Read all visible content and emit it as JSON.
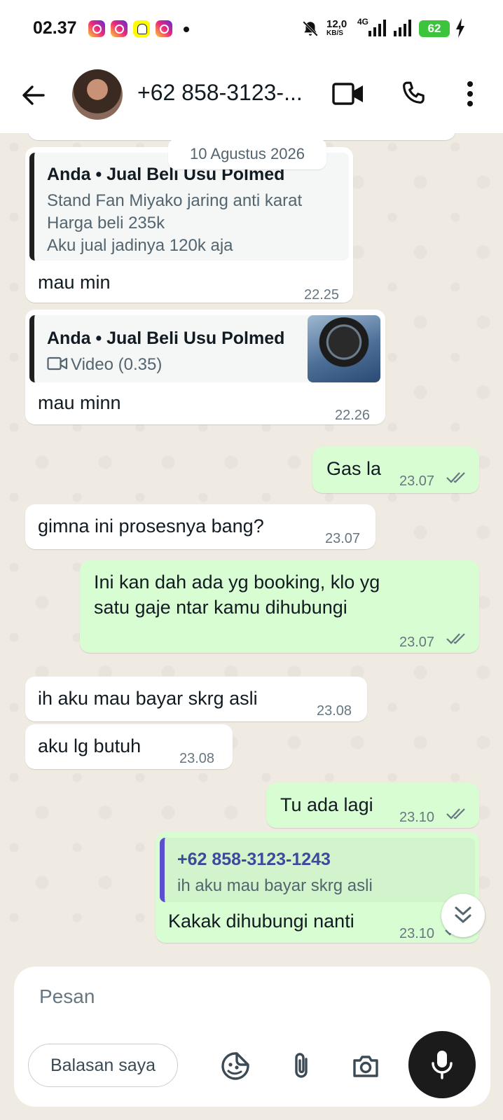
{
  "status_bar": {
    "time": "02.37",
    "net_speed": "12,0",
    "net_unit": "KB/S",
    "network_type": "4G",
    "battery": "62"
  },
  "header": {
    "contact_name": "+62 858-3123-...",
    "icons": [
      "back-arrow-icon",
      "video-call-icon",
      "voice-call-icon",
      "more-options-icon"
    ]
  },
  "chat": {
    "date_chip": "10 Agustus 2026",
    "messages": [
      {
        "direction": "in",
        "quote_author": "Anda • Jual Beli Usu Polmed",
        "quote_lines": [
          "Stand Fan Miyako jaring anti karat",
          "Harga beli 235k",
          "Aku jual jadinya 120k aja"
        ],
        "text": "mau min",
        "time": "22.25"
      },
      {
        "direction": "in",
        "quote_author": "Anda • Jual Beli Usu Polmed",
        "quote_media": "Video (0.35)",
        "text": "mau minn",
        "time": "22.26"
      },
      {
        "direction": "out",
        "text": "Gas la",
        "time": "23.07",
        "status": "read"
      },
      {
        "direction": "in",
        "text": "gimna ini prosesnya bang?",
        "time": "23.07"
      },
      {
        "direction": "out",
        "text_lines": [
          "Ini kan dah ada yg booking, klo yg",
          "satu gaje ntar kamu dihubungi"
        ],
        "time": "23.07",
        "status": "read"
      },
      {
        "direction": "in",
        "text": "ih aku mau bayar skrg asli",
        "time": "23.08"
      },
      {
        "direction": "in",
        "text": "aku lg butuh",
        "time": "23.08"
      },
      {
        "direction": "out",
        "text": "Tu ada lagi",
        "time": "23.10",
        "status": "read"
      },
      {
        "direction": "out",
        "quote_author": "+62 858-3123-1243",
        "quote_lines": [
          "ih aku mau bayar skrg asli"
        ],
        "text": "Kakak dihubungi nanti",
        "time": "23.10",
        "status": "read"
      }
    ]
  },
  "composer": {
    "placeholder": "Pesan",
    "quick_reply_chip": "Balasan saya",
    "icons": [
      "sticker-icon",
      "attach-icon",
      "camera-icon",
      "microphone-icon"
    ]
  },
  "colors": {
    "incoming_bubble": "#ffffff",
    "outgoing_bubble": "#d9fdd3",
    "chat_background": "#efeae2",
    "read_ticks": "#667781"
  }
}
